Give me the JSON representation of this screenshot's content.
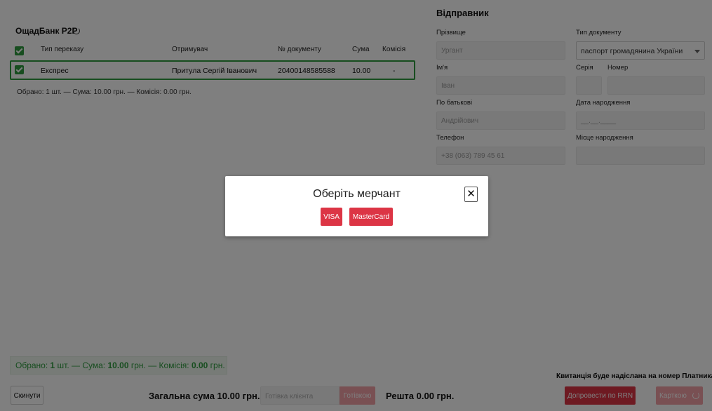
{
  "left_panel": {
    "title": "ОщадБанк P2P",
    "table": {
      "headers": [
        "Тип переказу",
        "Отримувач",
        "№ документу",
        "Сума",
        "Комісія"
      ],
      "rows": [
        [
          "Експрес",
          "Притула Сергій Іванович",
          "20400148585588",
          "10.00",
          "-"
        ]
      ]
    },
    "selection_summary": "Обрано: 1 шт. — Сума: 10.00 грн. — Комісія: 0.00 грн."
  },
  "sender": {
    "title": "Відправник",
    "surname_label": "Прізвище",
    "surname_value": "Ургант",
    "doc_type_label": "Тип документу",
    "doc_type_value": "паспорт громадянина України",
    "name_label": "Ім'я",
    "name_value": "Іван",
    "series_label": "Серія",
    "number_label": "Номер",
    "patronymic_label": "По батькові",
    "patronymic_value": "Андрійович",
    "birth_date_label": "Дата народження",
    "birth_date_placeholder": "__.__.____",
    "phone_label": "Телефон",
    "phone_value": "+38 (063) 789 45 61",
    "birth_place_label": "Місце народження"
  },
  "footer": {
    "summary_prefix": "Обрано: ",
    "summary_count": "1",
    "summary_mid1": " шт. — Сума: ",
    "summary_sum": "10.00",
    "summary_mid2": " грн. — Комісія: ",
    "summary_fee": "0.00",
    "summary_suffix": " грн.",
    "receipt_note": "Квитанція буде надіслана на номер Платника",
    "reset_label": "Скинути",
    "total_label": "Загальна сума 10.00 грн.",
    "cash_placeholder": "Готівка клієнта",
    "cash_button": "Готівкою",
    "change_label": "Решта 0.00 грн.",
    "rrn_button": "Допровести по RRN",
    "card_button": "Карткою"
  },
  "modal": {
    "title": "Оберіть мерчант",
    "close_symbol": "✕",
    "buttons": [
      "VISA",
      "MasterCard"
    ]
  },
  "colors": {
    "accent_green": "#2e9b3e",
    "danger_red": "#dc3545",
    "danger_red_disabled": "#f3a0a6",
    "overlay": "rgba(0,0,0,0.5)"
  }
}
